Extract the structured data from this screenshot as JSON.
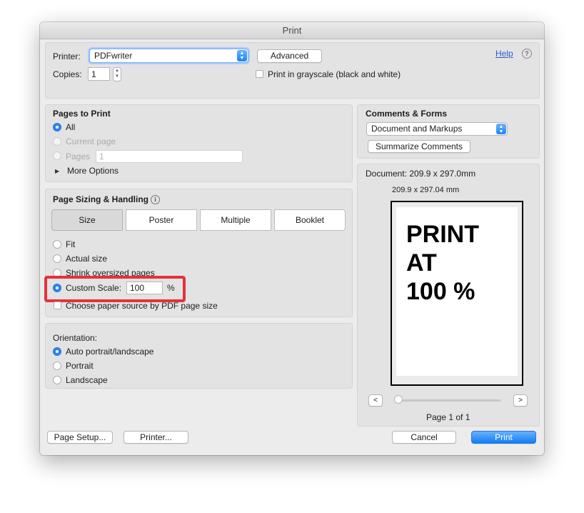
{
  "window": {
    "title": "Print"
  },
  "header": {
    "printer_label": "Printer:",
    "printer_value": "PDFwriter",
    "advanced_label": "Advanced",
    "help_label": "Help",
    "help_icon": "question-circle-icon",
    "copies_label": "Copies:",
    "copies_value": "1",
    "grayscale_label": "Print in grayscale (black and white)",
    "grayscale_checked": false
  },
  "pages_to_print": {
    "title": "Pages to Print",
    "all_label": "All",
    "current_label": "Current page",
    "pages_label": "Pages",
    "pages_value": "1",
    "more_options_label": "More Options",
    "selected": "All"
  },
  "sizing": {
    "title": "Page Sizing & Handling",
    "info_icon": "info-circle-icon",
    "tabs": [
      "Size",
      "Poster",
      "Multiple",
      "Booklet"
    ],
    "selected_tab": "Size",
    "fit_label": "Fit",
    "actual_label": "Actual size",
    "shrink_label": "Shrink oversized pages",
    "custom_label": "Custom Scale:",
    "custom_value": "100",
    "percent_sign": "%",
    "selected": "Custom Scale",
    "paper_source_label": "Choose paper source by PDF page size",
    "paper_source_checked": false,
    "highlight_color": "#e5323a"
  },
  "orientation": {
    "title": "Orientation:",
    "options": [
      "Auto portrait/landscape",
      "Portrait",
      "Landscape"
    ],
    "selected": "Auto portrait/landscape"
  },
  "comments": {
    "title": "Comments & Forms",
    "value": "Document and Markups",
    "summarize_label": "Summarize Comments"
  },
  "preview": {
    "document_label": "Document: 209.9 x 297.0mm",
    "size_label": "209.9 x 297.04 mm",
    "page_text": [
      "PRINT",
      "AT",
      "100 %"
    ],
    "prev_label": "<",
    "next_label": ">",
    "page_indicator": "Page 1 of 1",
    "slider_position_fraction": 0
  },
  "footer": {
    "page_setup_label": "Page Setup...",
    "printer_label": "Printer...",
    "cancel_label": "Cancel",
    "print_label": "Print"
  },
  "colors": {
    "accent": "#1a84f6",
    "window_bg": "#ececec",
    "panel_bg": "#e3e3e3"
  }
}
